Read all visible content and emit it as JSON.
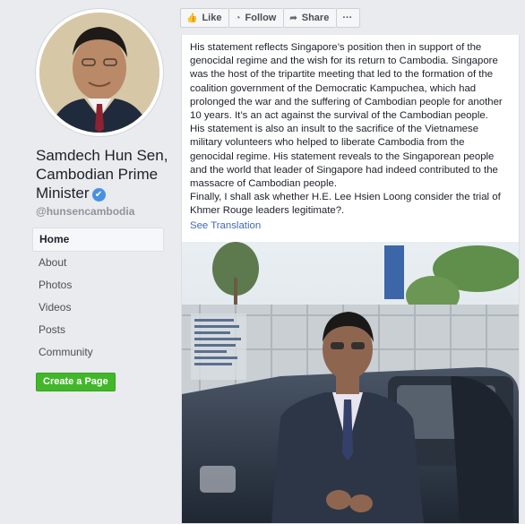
{
  "profile": {
    "name": "Samdech Hun Sen, Cambodian Prime Minister",
    "handle": "@hunsencambodia",
    "verified_icon": "check-icon"
  },
  "nav": [
    {
      "label": "Home",
      "active": true
    },
    {
      "label": "About"
    },
    {
      "label": "Photos"
    },
    {
      "label": "Videos"
    },
    {
      "label": "Posts"
    },
    {
      "label": "Community"
    }
  ],
  "create_page_label": "Create a Page",
  "actions": {
    "like": "Like",
    "follow": "Follow",
    "share": "Share",
    "more": "···"
  },
  "post": {
    "text": "His statement reflects Singapore’s position then in support of the genocidal regime and the wish for its return to Cambodia. Singapore was the host of the tripartite meeting that led to the formation of the coalition government of the Democratic Kampuchea, which had prolonged the war and the suffering of Cambodian people for another 10 years. It’s an act against the survival of the Cambodian people. His statement is also an insult to the sacrifice of the Vietnamese military volunteers who helped to liberate Cambodia from the genocidal regime. His statement reveals to the Singaporean people and the world that leader of Singapore had indeed contributed to the massacre of Cambodian people.\nFinally, I shall ask whether H.E. Lee Hsien Loong consider the trial of Khmer Rouge leaders legitimate?.",
    "see_translation": "See Translation"
  },
  "colors": {
    "link": "#4267b2",
    "create_button": "#42b72a",
    "verified": "#4a90e2"
  }
}
